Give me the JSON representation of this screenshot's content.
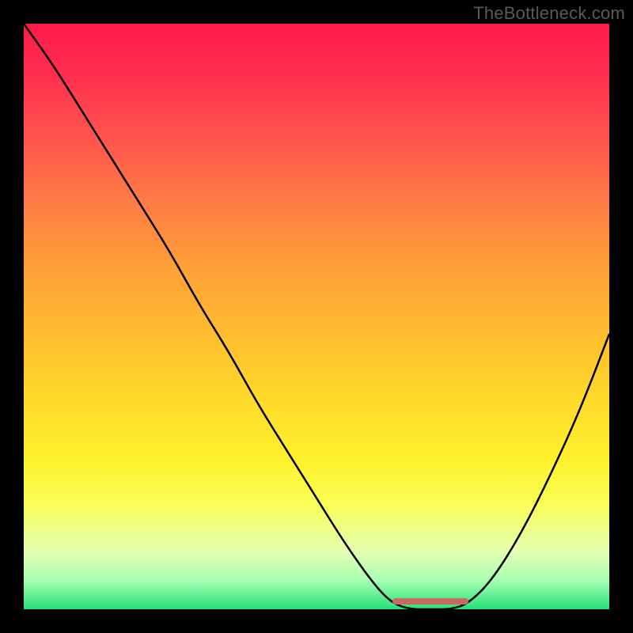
{
  "watermark": "TheBottleneck.com",
  "colors": {
    "background": "#000000",
    "curve_stroke": "#000000",
    "min_band": "#c96a62",
    "watermark_text": "#5a5a5a"
  },
  "chart_data": {
    "type": "line",
    "title": "",
    "xlabel": "",
    "ylabel": "",
    "xlim": [
      0,
      100
    ],
    "ylim": [
      0,
      100
    ],
    "x": [
      0,
      5,
      10,
      15,
      20,
      25,
      30,
      35,
      40,
      45,
      50,
      55,
      60,
      63,
      66,
      70,
      73,
      76,
      80,
      85,
      90,
      95,
      100
    ],
    "values": [
      100,
      93,
      85,
      77,
      69,
      61,
      52,
      44,
      35,
      27,
      19,
      11,
      4,
      1,
      0,
      0,
      0,
      1,
      5,
      13,
      23,
      34,
      47
    ],
    "min_plateau": {
      "x_start": 63,
      "x_end": 76,
      "y": 0
    },
    "notes": "Values estimated from pixel positions; y is percent of full plot height (0 = bottom/green, 100 = top/red). Curve descends steeply from x=0, reaches a flat minimum between roughly x=63 and x=76, then rises moderately toward the right edge."
  }
}
